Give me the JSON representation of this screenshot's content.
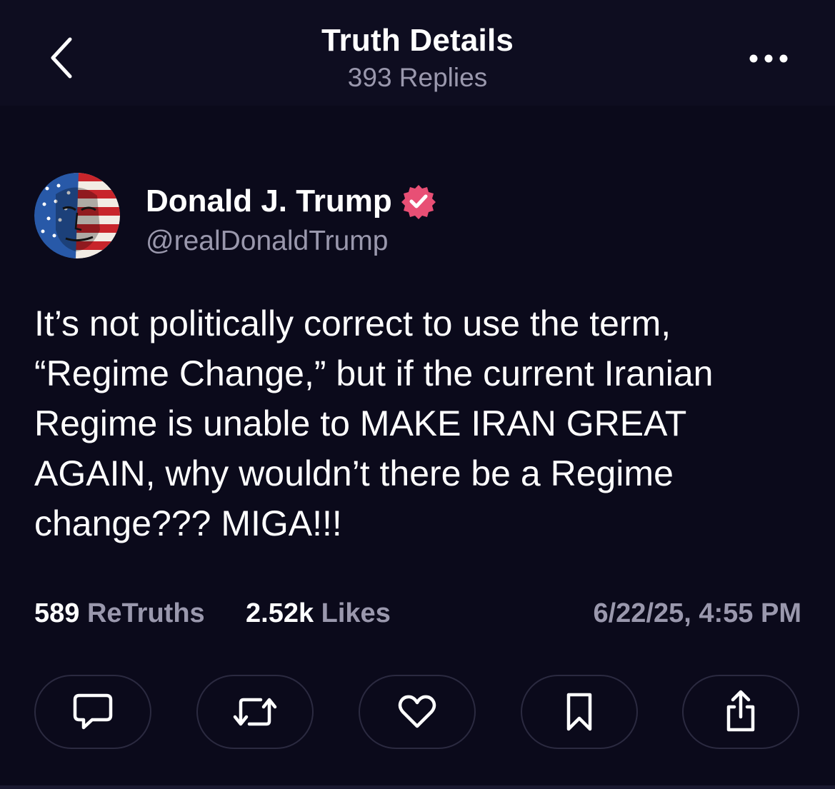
{
  "header": {
    "title": "Truth Details",
    "subtitle": "393 Replies",
    "back_icon": "chevron-left-icon",
    "more_icon": "more-horizontal-icon"
  },
  "author": {
    "name": "Donald J. Trump",
    "handle": "@realDonaldTrump",
    "verified": true,
    "verified_color": "#e84f75"
  },
  "post": {
    "text": "It’s not politically correct to use the term,\n“Regime Change,” but if the current Iranian\nRegime is unable to MAKE IRAN GREAT\nAGAIN, why wouldn’t there be a Regime\nchange??? MIGA!!!"
  },
  "stats": {
    "retruths_count": "589",
    "retruths_label": "ReTruths",
    "likes_count": "2.52k",
    "likes_label": "Likes",
    "timestamp": "6/22/25, 4:55 PM"
  },
  "actions": [
    {
      "name": "reply",
      "icon": "comment-icon"
    },
    {
      "name": "retruth",
      "icon": "retruth-icon"
    },
    {
      "name": "like",
      "icon": "heart-icon"
    },
    {
      "name": "bookmark",
      "icon": "bookmark-icon"
    },
    {
      "name": "share",
      "icon": "share-icon"
    }
  ],
  "colors": {
    "background": "#0b0a1b",
    "text_primary": "#ffffff",
    "text_secondary": "#9a98ad",
    "button_border": "#2b2a40"
  }
}
